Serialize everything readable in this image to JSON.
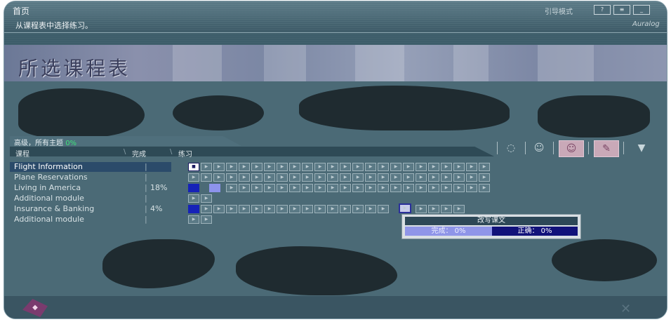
{
  "window": {
    "home_title": "首页",
    "instruction": "从课程表中选择练习。",
    "guide_mode": "引导模式",
    "logo": "Auralog"
  },
  "banner": {
    "title": "所选课程表"
  },
  "level": {
    "label": "高级，所有主题",
    "percent": "0%"
  },
  "columns": {
    "course": "课程",
    "done": "完成",
    "practice": "练习"
  },
  "toolbar": {
    "icons": [
      "speech-bubble-icon",
      "head-speech-icon",
      "head-sound-icon",
      "head-write-icon",
      "book-icon"
    ]
  },
  "courses": [
    {
      "name": "Flight Information",
      "pct": "",
      "selected": true
    },
    {
      "name": "Plane Reservations",
      "pct": ""
    },
    {
      "name": "Living in America",
      "pct": "18%"
    },
    {
      "name": "Additional module",
      "pct": ""
    },
    {
      "name": "Insurance & Banking",
      "pct": "4%"
    },
    {
      "name": "Additional module",
      "pct": ""
    }
  ],
  "popup": {
    "title": "改写课文",
    "done_label": "完成：",
    "done_value": "0%",
    "correct_label": "正确：",
    "correct_value": "0%"
  },
  "bottom": {
    "close_symbol": "✕"
  }
}
